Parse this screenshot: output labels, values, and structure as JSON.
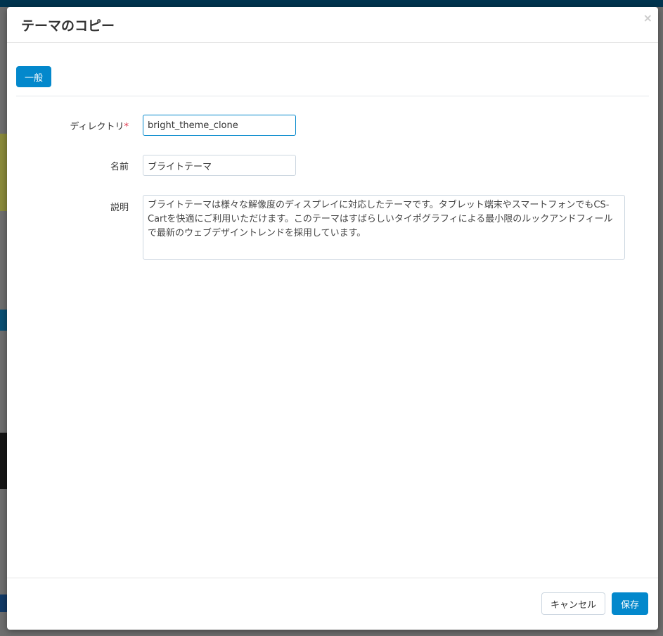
{
  "modal": {
    "title": "テーマのコピー",
    "close_label": "×",
    "tabs": [
      {
        "label": "一般"
      }
    ],
    "fields": {
      "directory": {
        "label": "ディレクトリ",
        "required_mark": "*",
        "value": "bright_theme_clone"
      },
      "name": {
        "label": "名前",
        "value": "ブライトテーマ"
      },
      "description": {
        "label": "説明",
        "value": "ブライトテーマは様々な解像度のディスプレイに対応したテーマです。タブレット端末やスマートフォンでもCS-Cartを快適にご利用いただけます。このテーマはすばらしいタイポグラフィによる最小限のルックアンドフィールで最新のウェブデザイントレンドを採用しています。"
      }
    },
    "buttons": {
      "cancel": "キャンセル",
      "save": "保存"
    }
  }
}
